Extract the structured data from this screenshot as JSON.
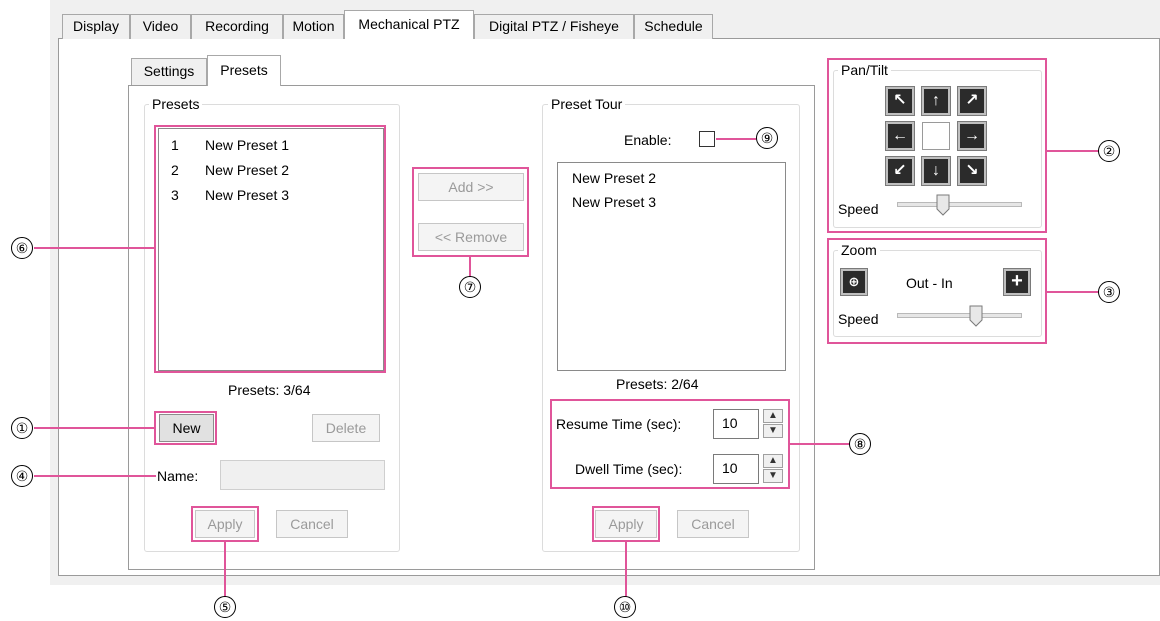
{
  "tabs": [
    "Display",
    "Video",
    "Recording",
    "Motion",
    "Mechanical PTZ",
    "Digital PTZ / Fisheye",
    "Schedule"
  ],
  "active_tab": "Mechanical PTZ",
  "subtabs": [
    "Settings",
    "Presets"
  ],
  "active_subtab": "Presets",
  "presets": {
    "group_title": "Presets",
    "items": [
      {
        "num": "1",
        "name": "New Preset 1"
      },
      {
        "num": "2",
        "name": "New Preset 2"
      },
      {
        "num": "3",
        "name": "New Preset 3"
      }
    ],
    "count_label": "Presets:  3/64",
    "new_label": "New",
    "delete_label": "Delete",
    "name_label": "Name:",
    "name_value": "",
    "apply_label": "Apply",
    "cancel_label": "Cancel"
  },
  "transfer": {
    "add_label": "Add >>",
    "remove_label": "<< Remove"
  },
  "tour": {
    "group_title": "Preset Tour",
    "enable_label": "Enable:",
    "enable_checked": false,
    "items": [
      "New Preset 2",
      "New Preset 3"
    ],
    "count_label": "Presets:  2/64",
    "resume_label": "Resume Time (sec):",
    "resume_value": "10",
    "dwell_label": "Dwell Time (sec):",
    "dwell_value": "10",
    "apply_label": "Apply",
    "cancel_label": "Cancel"
  },
  "pantilt": {
    "group_title": "Pan/Tilt",
    "speed_label": "Speed",
    "speed_level": 0.35
  },
  "zoom": {
    "group_title": "Zoom",
    "range_label": "Out - In",
    "speed_label": "Speed",
    "speed_level": 0.65
  },
  "callouts": {
    "c1": "①",
    "c2": "②",
    "c3": "③",
    "c4": "④",
    "c5": "⑤",
    "c6": "⑥",
    "c7": "⑦",
    "c8": "⑧",
    "c9": "⑨",
    "c10": "⑩"
  },
  "colors": {
    "highlight": "#e0559a"
  }
}
